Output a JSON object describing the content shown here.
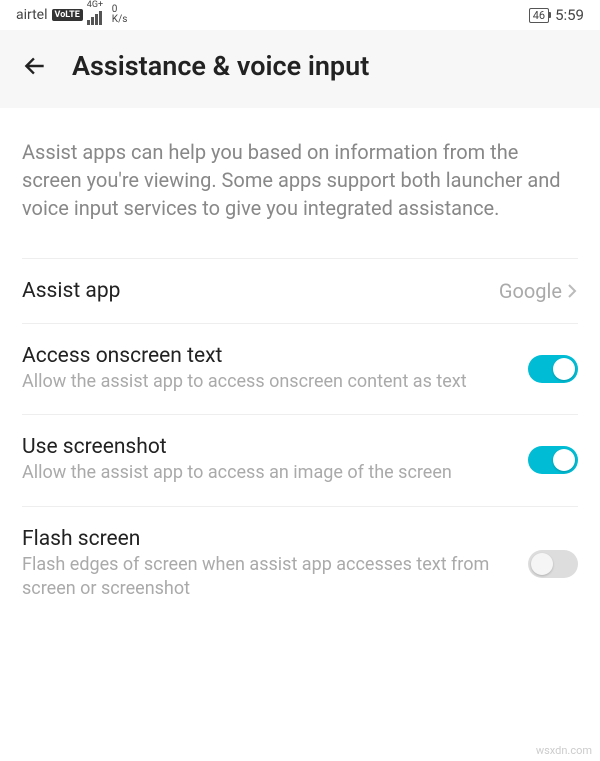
{
  "status": {
    "carrier": "airtel",
    "volte": "VoLTE",
    "signal_type": "4G+",
    "data_value": "0",
    "data_unit": "K/s",
    "battery": "46",
    "time": "5:59"
  },
  "header": {
    "title": "Assistance & voice input"
  },
  "description": "Assist apps can help you based on information from the screen you're viewing. Some apps support both launcher and voice input services to give you integrated assistance.",
  "settings": {
    "assist_app": {
      "label": "Assist app",
      "value": "Google"
    },
    "access_text": {
      "label": "Access onscreen text",
      "sub": "Allow the assist app to access onscreen content as text",
      "on": true
    },
    "use_screenshot": {
      "label": "Use screenshot",
      "sub": "Allow the assist app to access an image of the screen",
      "on": true
    },
    "flash_screen": {
      "label": "Flash screen",
      "sub": "Flash edges of screen when assist app accesses text from screen or screenshot",
      "on": false
    }
  },
  "watermark": "wsxdn.com"
}
